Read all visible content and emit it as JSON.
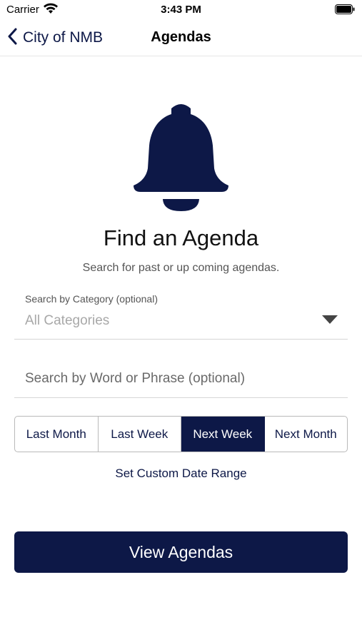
{
  "status_bar": {
    "carrier": "Carrier",
    "time": "3:43 PM",
    "wifi_icon": "wifi-icon",
    "battery_icon": "battery-full-icon"
  },
  "nav": {
    "back_label": "City of NMB",
    "back_icon": "chevron-left-icon",
    "title": "Agendas"
  },
  "hero": {
    "icon": "bell-icon",
    "heading": "Find an Agenda",
    "subheading": "Search for past or up coming agendas."
  },
  "category": {
    "label": "Search by Category (optional)",
    "selected": "All Categories",
    "dropdown_icon": "caret-down-icon"
  },
  "search": {
    "placeholder": "Search by Word or Phrase (optional)",
    "value": ""
  },
  "date_range": {
    "options": [
      "Last Month",
      "Last Week",
      "Next Week",
      "Next Month"
    ],
    "selected": "Next Week",
    "custom_label": "Set Custom Date Range"
  },
  "submit": {
    "label": "View Agendas"
  },
  "colors": {
    "brand": "#0d1847",
    "background": "#ffffff",
    "placeholder": "#a8a8a8",
    "divider": "#d6d6d6"
  }
}
